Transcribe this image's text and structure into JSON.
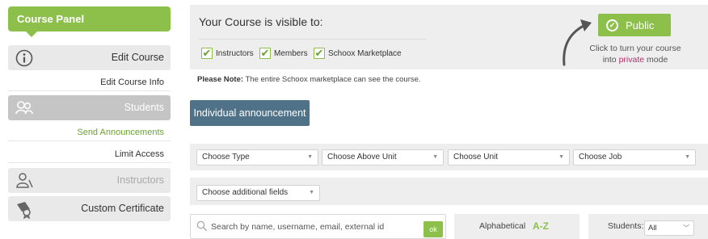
{
  "sidebar": {
    "header": "Course Panel",
    "items": [
      {
        "label": "Edit Course",
        "icon": "info-icon"
      },
      {
        "label": "Edit Course Info"
      },
      {
        "label": "Students",
        "icon": "students-icon"
      },
      {
        "label": "Send Announcements"
      },
      {
        "label": "Limit Access"
      },
      {
        "label": "Instructors",
        "icon": "instructor-icon"
      },
      {
        "label": "Custom Certificate",
        "icon": "certificate-icon"
      }
    ]
  },
  "visibility": {
    "title": "Your Course is visible to:",
    "options": [
      {
        "label": "Instructors",
        "checked": true
      },
      {
        "label": "Members",
        "checked": true
      },
      {
        "label": "Schoox Marketplace",
        "checked": true
      }
    ],
    "public_button": "Public",
    "hint_line1": "Click to turn your course",
    "hint_into": "into",
    "hint_private": "private",
    "hint_mode": "mode"
  },
  "note": {
    "bold": "Please Note:",
    "text": " The entire Schoox marketplace can see the course."
  },
  "announcement_button": "Individual announcement",
  "filters": {
    "type": "Choose Type",
    "above_unit": "Choose Above Unit",
    "unit": "Choose Unit",
    "job": "Choose Job",
    "additional": "Choose additional fields"
  },
  "search": {
    "placeholder": "Search by name, username, email, external id",
    "ok": "ok"
  },
  "sort": {
    "label": "Alphabetical",
    "az": "A-Z"
  },
  "students_filter": {
    "label": "Students:",
    "value": "All"
  },
  "colors": {
    "accent_green": "#8cc04b",
    "announce_blue": "#4f7288",
    "private_magenta": "#b0336e"
  }
}
